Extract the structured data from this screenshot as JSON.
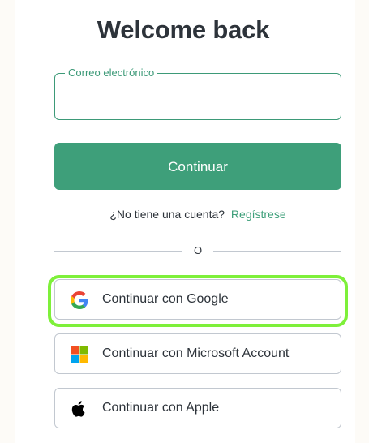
{
  "page": {
    "title": "Welcome back"
  },
  "email_field": {
    "label": "Correo electrónico",
    "value": "",
    "placeholder": ""
  },
  "continue_button": {
    "label": "Continuar"
  },
  "signup": {
    "prompt": "¿No tiene una cuenta?",
    "link": "Regístrese"
  },
  "divider": {
    "text": "O"
  },
  "social_buttons": [
    {
      "label": "Continuar con Google",
      "icon": "google-icon",
      "highlighted": true
    },
    {
      "label": "Continuar con Microsoft Account",
      "icon": "microsoft-icon",
      "highlighted": false
    },
    {
      "label": "Continuar con Apple",
      "icon": "apple-icon",
      "highlighted": false
    }
  ],
  "colors": {
    "accent": "#3e9f7a",
    "highlight_ring": "#7ef03a",
    "text": "#2d333a",
    "border": "#c2c8d0"
  }
}
